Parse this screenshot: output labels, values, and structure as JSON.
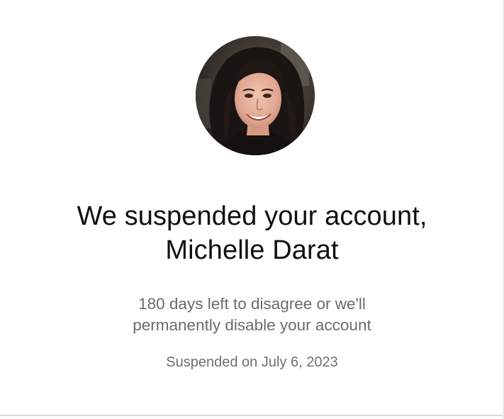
{
  "profile": {
    "avatar_description": "profile-photo"
  },
  "heading": {
    "line1": "We suspended your account,",
    "line2": "Michelle Darat"
  },
  "message": {
    "line1": "180 days left to disagree or we'll",
    "line2": "permanently disable your account"
  },
  "status": {
    "suspended_date": "Suspended on July 6, 2023"
  }
}
